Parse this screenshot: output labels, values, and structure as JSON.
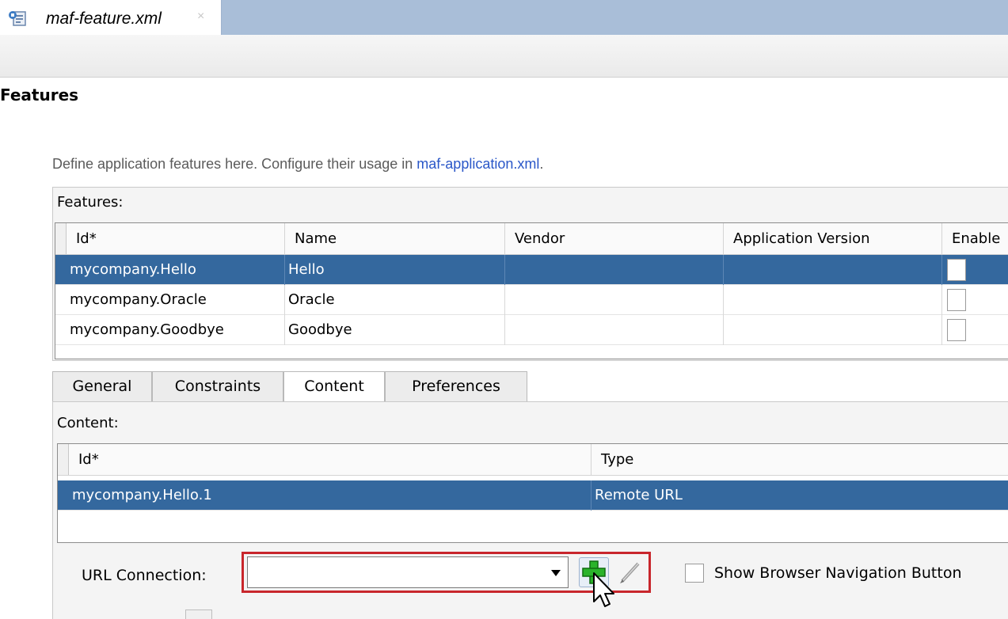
{
  "editor": {
    "tab_label": "maf-feature.xml",
    "tab_close": "×"
  },
  "page": {
    "heading": "Features",
    "description_prefix": "Define application features here. Configure their usage in ",
    "description_link": "maf-application.xml",
    "description_suffix": "."
  },
  "features": {
    "label": "Features:",
    "columns": [
      "Id*",
      "Name",
      "Vendor",
      "Application Version",
      "Enable"
    ],
    "rows": [
      {
        "id": "mycompany.Hello",
        "name": "Hello",
        "vendor": "",
        "app_version": "",
        "selected": true
      },
      {
        "id": "mycompany.Oracle",
        "name": "Oracle",
        "vendor": "",
        "app_version": "",
        "selected": false
      },
      {
        "id": "mycompany.Goodbye",
        "name": "Goodbye",
        "vendor": "",
        "app_version": "",
        "selected": false
      }
    ]
  },
  "tabs": {
    "items": [
      "General",
      "Constraints",
      "Content",
      "Preferences"
    ],
    "active": "Content"
  },
  "content": {
    "label": "Content:",
    "columns": [
      "Id*",
      "Type"
    ],
    "rows": [
      {
        "id": "mycompany.Hello.1",
        "type": "Remote URL",
        "selected": true
      }
    ]
  },
  "url_connection": {
    "label": "URL Connection:",
    "value": "",
    "dropdown_icon": "chevron-down-icon",
    "add_icon": "green-plus-icon",
    "edit_icon": "pencil-icon"
  },
  "show_browser_nav": {
    "label": "Show Browser Navigation Button",
    "checked": false
  },
  "colors": {
    "selection": "#34689e",
    "tab_strip": "#a9bed8",
    "link": "#2a57c8",
    "highlight": "#c8262c",
    "add_icon_green": "#2bb32b"
  }
}
